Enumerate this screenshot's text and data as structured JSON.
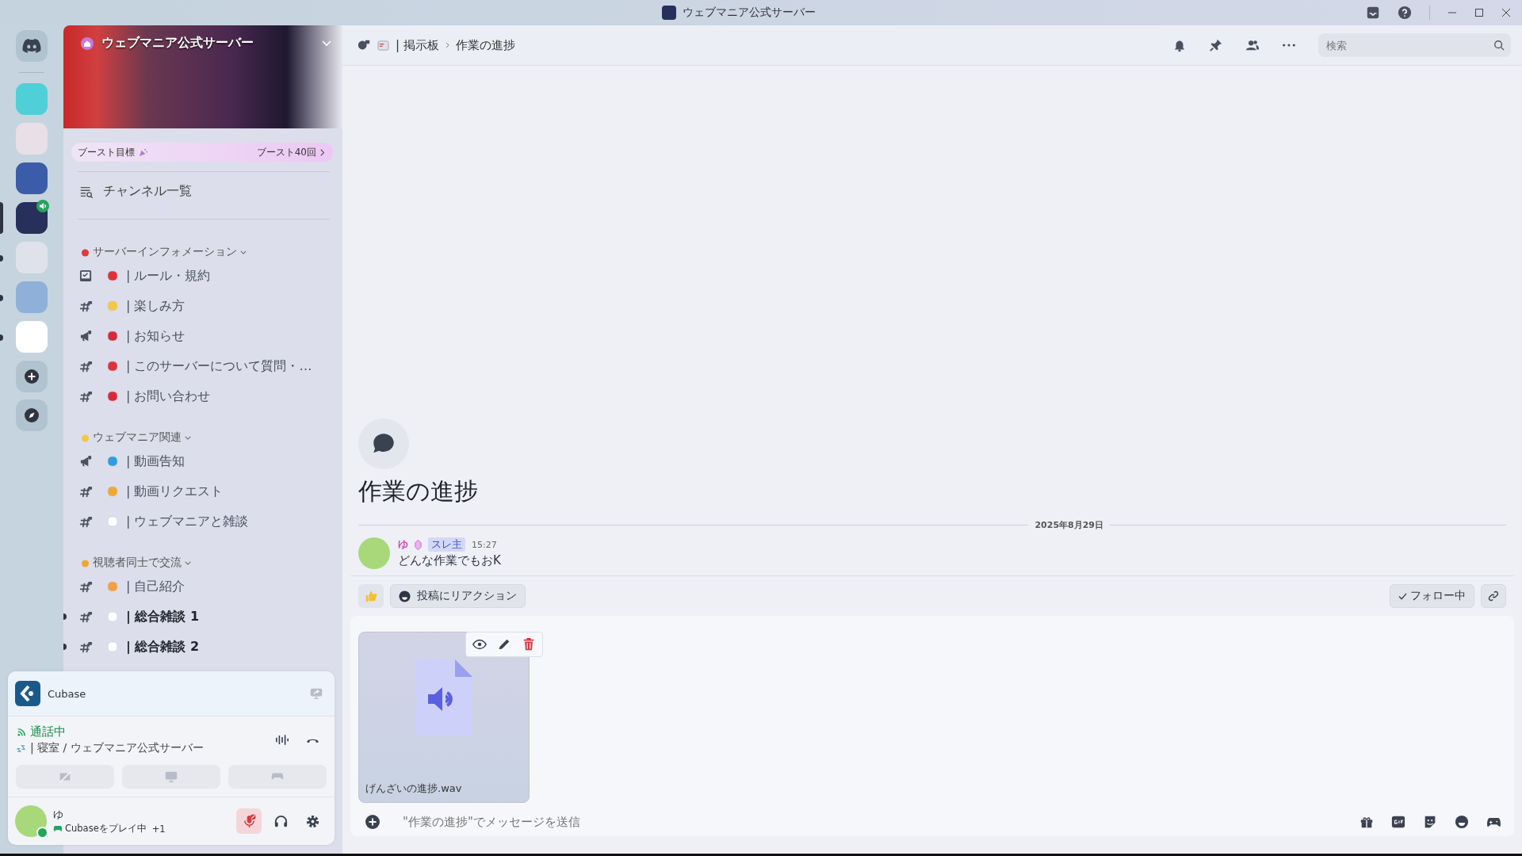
{
  "window": {
    "title": "ウェブマニア公式サーバー"
  },
  "servers": [
    {
      "selected": false,
      "unread": false,
      "in_voice": false
    },
    {
      "selected": false,
      "unread": false,
      "in_voice": false
    },
    {
      "selected": false,
      "unread": false,
      "in_voice": false
    },
    {
      "selected": true,
      "unread": false,
      "in_voice": true
    },
    {
      "selected": false,
      "unread": true,
      "in_voice": false
    },
    {
      "selected": false,
      "unread": true,
      "in_voice": false
    },
    {
      "selected": false,
      "unread": true,
      "in_voice": false
    }
  ],
  "server_header": {
    "name": "ウェブマニア公式サーバー"
  },
  "boost": {
    "label": "ブースト目標",
    "count": "ブースト40回"
  },
  "channel_browser": "チャンネル一覧",
  "categories": [
    {
      "name": "サーバーインフォメーション",
      "channels": [
        {
          "kind": "rules",
          "name": "| ルール・規約",
          "unread": false
        },
        {
          "kind": "text",
          "name": "| 楽しみ方",
          "unread": false
        },
        {
          "kind": "announcement",
          "name": "| お知らせ",
          "unread": false
        },
        {
          "kind": "text",
          "name": "| このサーバーについて質問・…",
          "unread": false
        },
        {
          "kind": "text",
          "name": "| お問い合わせ",
          "unread": false
        }
      ]
    },
    {
      "name": "ウェブマニア関連",
      "channels": [
        {
          "kind": "announcement",
          "name": "| 動画告知",
          "unread": false
        },
        {
          "kind": "text",
          "name": "| 動画リクエスト",
          "unread": false
        },
        {
          "kind": "text",
          "name": "| ウェブマニアと雑談",
          "unread": false
        }
      ]
    },
    {
      "name": "視聴者同士で交流",
      "channels": [
        {
          "kind": "text",
          "name": "| 自己紹介",
          "unread": false
        },
        {
          "kind": "text",
          "name": "| 総合雑談 1",
          "unread": true
        },
        {
          "kind": "text",
          "name": "| 総合雑談 2",
          "unread": true
        }
      ]
    }
  ],
  "voice_panel": {
    "activity": "Cubase",
    "status": "通話中",
    "location": "| 寝室 / ウェブマニア公式サーバー"
  },
  "user": {
    "name": "ゆ",
    "activity": "Cubaseをプレイ中",
    "extra": "+1",
    "muted": true
  },
  "breadcrumb": {
    "parent": "| 掲示板",
    "current": "作業の進捗"
  },
  "search": {
    "placeholder": "検索"
  },
  "post": {
    "title": "作業の進捗",
    "date": "2025年8月29日",
    "author": "ゆ",
    "tag": "スレ主",
    "time": "15:27",
    "text": "どんな作業でもおK"
  },
  "reaction_button": "投稿にリアクション",
  "follow_button": {
    "label": "フォロー中",
    "following": true
  },
  "attachment": {
    "filename": "げんざいの進捗.wav"
  },
  "composer": {
    "placeholder": "\"作業の進捗\"でメッセージを送信"
  }
}
